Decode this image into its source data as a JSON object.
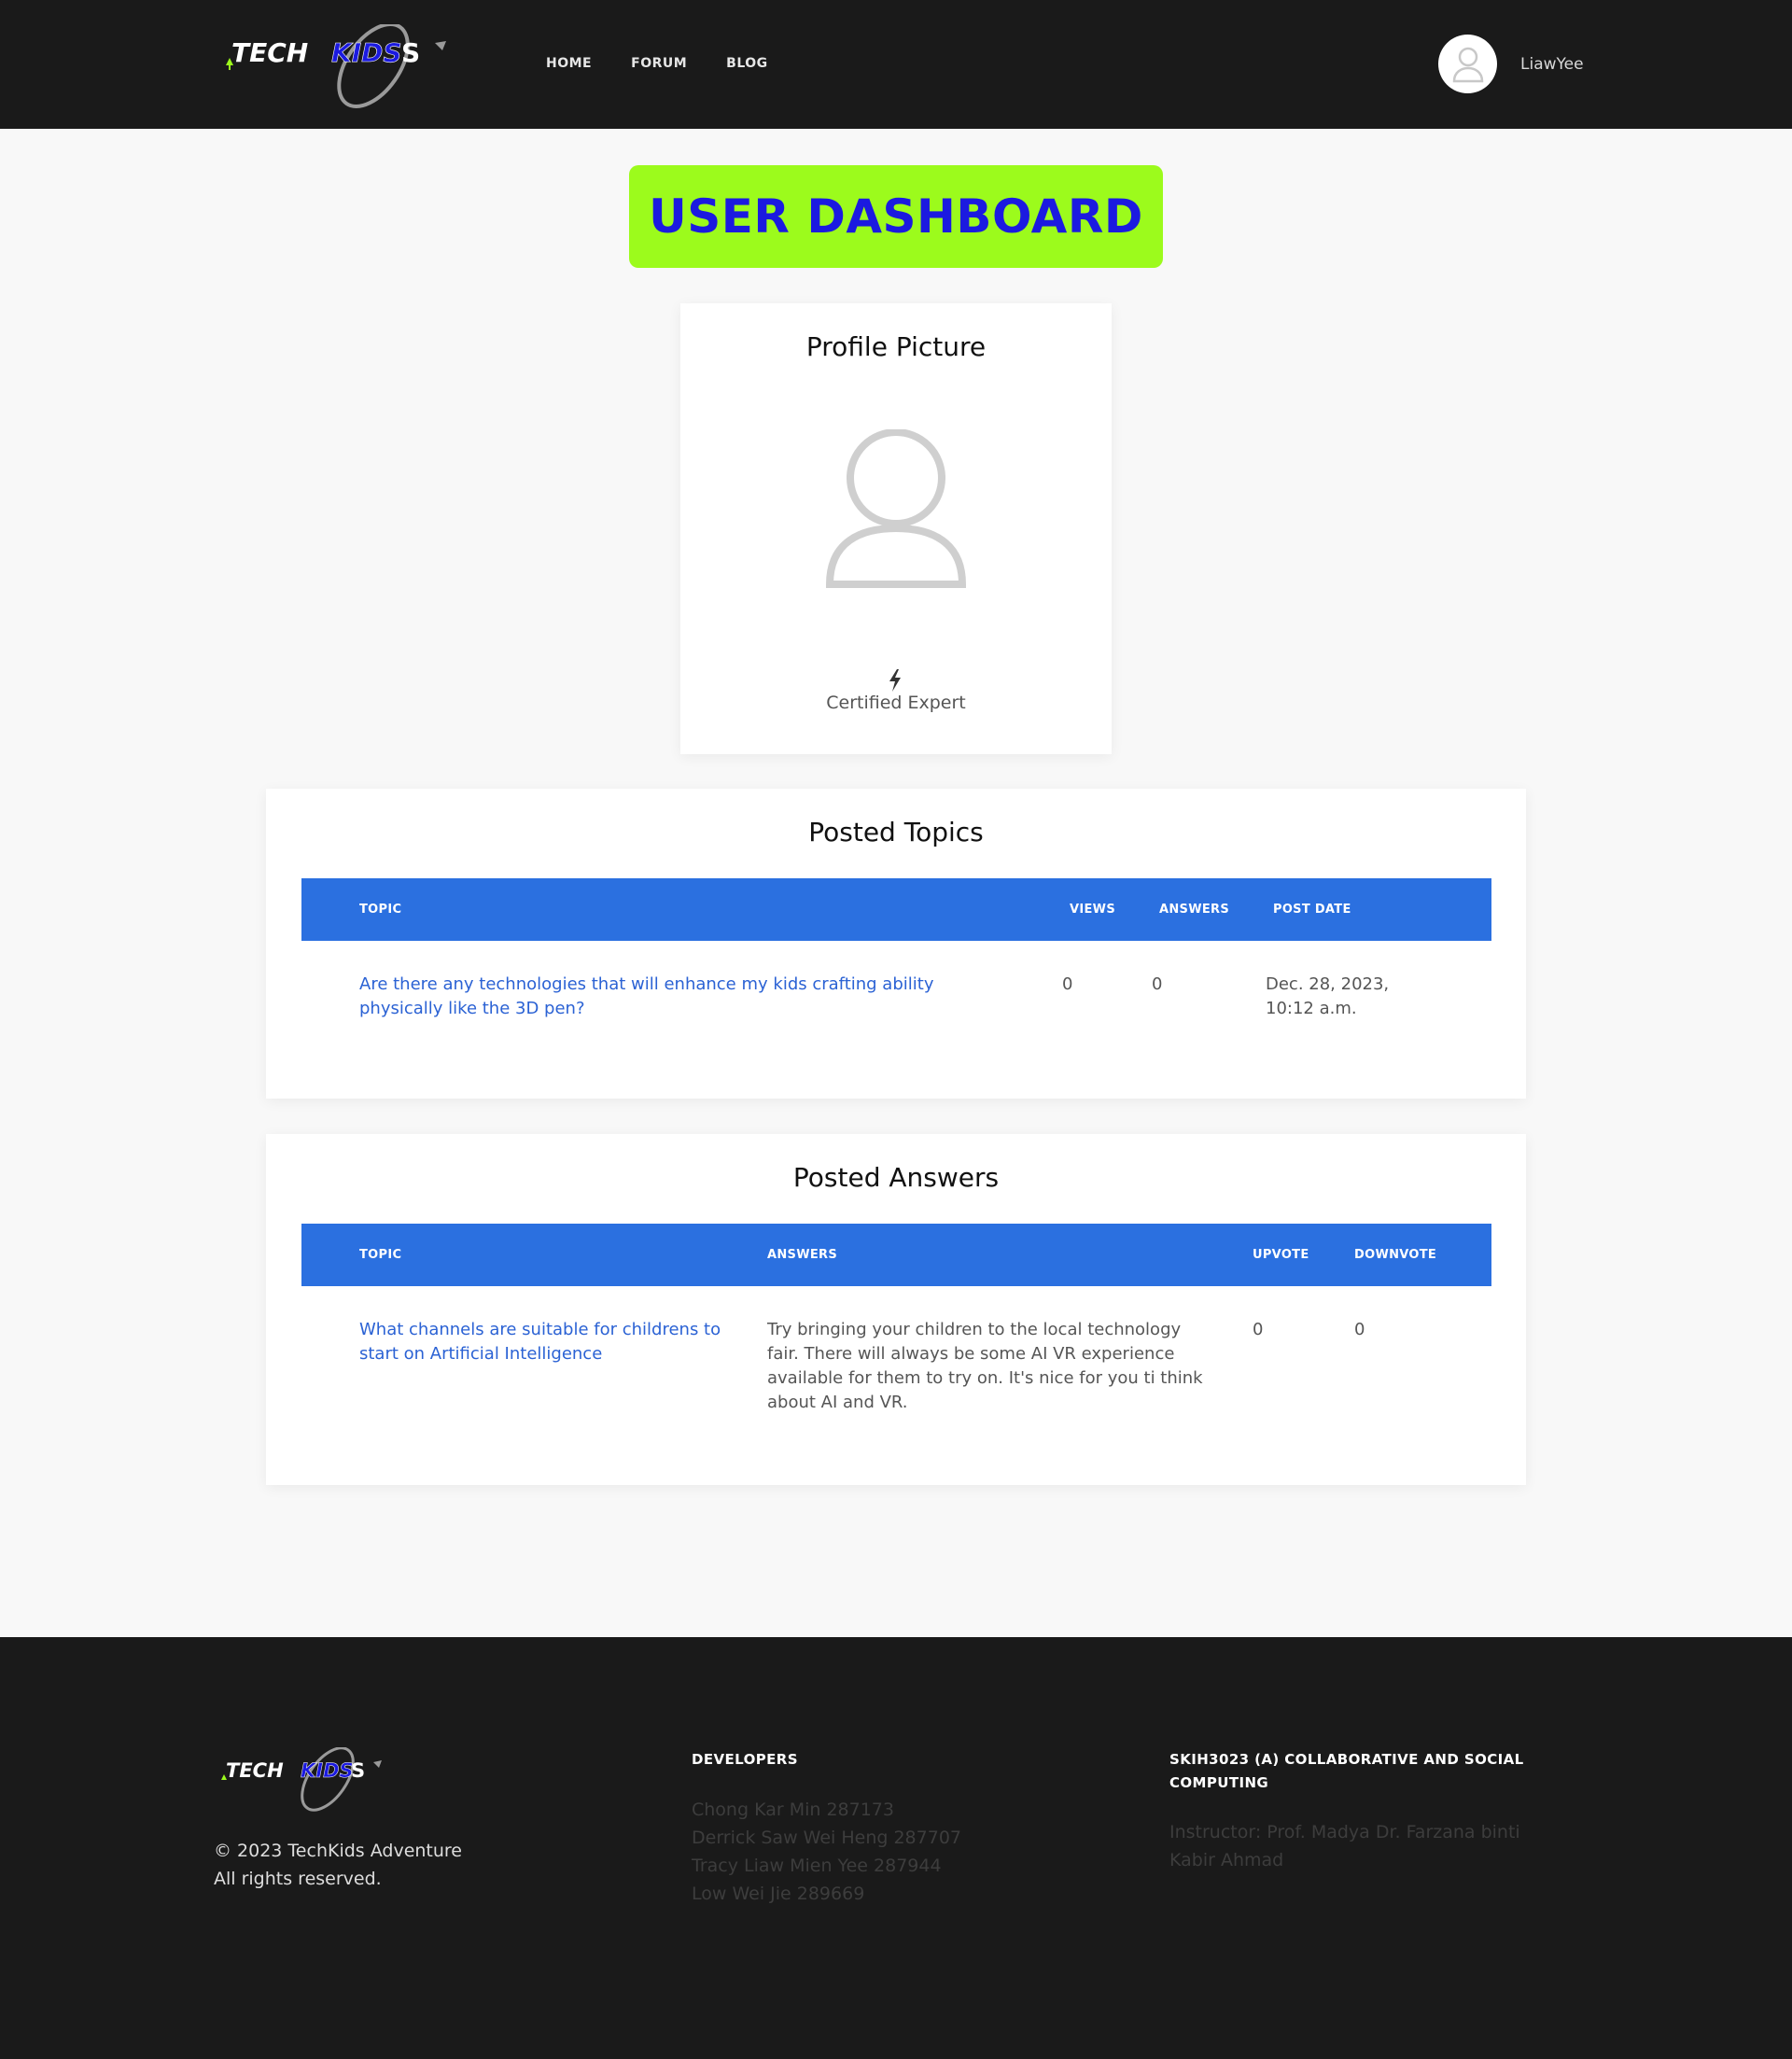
{
  "header": {
    "nav": [
      "HOME",
      "FORUM",
      "BLOG"
    ],
    "username": "LiawYee"
  },
  "logo": {
    "text_tech": "TECH",
    "text_kids": "KIDS"
  },
  "page_title": "USER DASHBOARD",
  "profile": {
    "heading": "Profile Picture",
    "badge": "Certified Expert",
    "badge_icon": "bolt-icon"
  },
  "posted_topics": {
    "heading": "Posted Topics",
    "columns": [
      "TOPIC",
      "VIEWS",
      "ANSWERS",
      "POST DATE"
    ],
    "rows": [
      {
        "topic": "Are there any technologies that will enhance my kids crafting ability physically like the 3D pen?",
        "views": "0",
        "answers": "0",
        "post_date": "Dec. 28, 2023, 10:12 a.m."
      }
    ]
  },
  "posted_answers": {
    "heading": "Posted Answers",
    "columns": [
      "TOPIC",
      "ANSWERS",
      "UPVOTE",
      "DOWNVOTE"
    ],
    "rows": [
      {
        "topic": "What channels are suitable for childrens to start on Artificial Intelligence",
        "answer": "Try bringing your children to the local technology fair. There will always be some AI VR experience available for them to try on. It's nice for you ti think about AI and VR.",
        "upvote": "0",
        "downvote": "0"
      }
    ]
  },
  "footer": {
    "copyright_line1": "© 2023 TechKids Adventure",
    "copyright_line2": "All rights reserved.",
    "developers_heading": "DEVELOPERS",
    "developers": [
      "Chong Kar Min 287173",
      "Derrick Saw Wei Heng 287707",
      "Tracy Liaw Mien Yee 287944",
      "Low Wei Jie 289669"
    ],
    "course_heading": "SKIH3023 (A) COLLABORATIVE AND SOCIAL COMPUTING",
    "instructor": "Instructor: Prof. Madya Dr. Farzana binti Kabir Ahmad"
  },
  "colors": {
    "header_bg": "#1a1a1a",
    "title_bg": "#9cfb1c",
    "title_text": "#1b1ae0",
    "table_header": "#2b70e0",
    "link": "#2b62d4"
  }
}
